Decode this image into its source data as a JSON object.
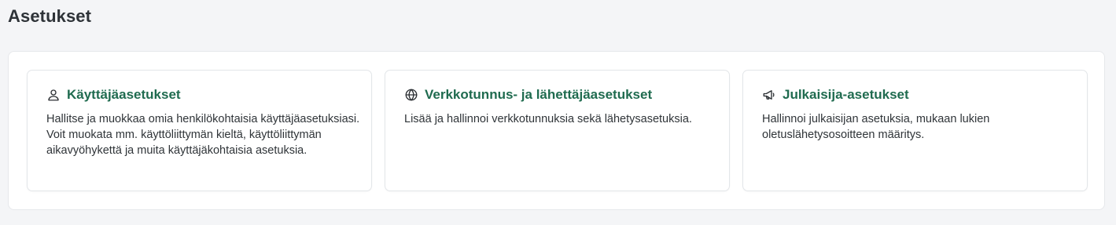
{
  "page": {
    "title": "Asetukset"
  },
  "cards": [
    {
      "icon": "user-icon",
      "title": "Käyttäjäasetukset",
      "description": "Hallitse ja muokkaa omia henkilökohtaisia käyttäjäasetuksiasi. Voit muokata mm. käyttöliittymän kieltä, käyttöliittymän aikavyöhykettä ja muita käyttäjäkohtaisia asetuksia."
    },
    {
      "icon": "globe-icon",
      "title": "Verkkotunnus- ja lähettäjäasetukset",
      "description": "Lisää ja hallinnoi verkkotunnuksia sekä lähetysasetuksia."
    },
    {
      "icon": "megaphone-icon",
      "title": "Julkaisija-asetukset",
      "description": "Hallinnoi julkaisijan asetuksia, mukaan lukien oletuslähetysosoitteen määritys."
    }
  ],
  "colors": {
    "accent": "#1f6b4f",
    "background": "#f4f5f7",
    "panel": "#ffffff",
    "border": "#e3e6e9"
  }
}
